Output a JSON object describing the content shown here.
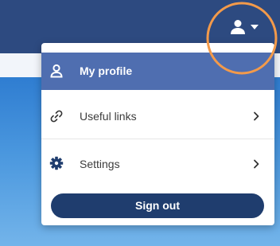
{
  "colors": {
    "header_bg": "#2d4a80",
    "menu_active_bg": "#4f6eb0",
    "signout_bg": "#1f3d6e",
    "highlight_ring": "#f39a4a",
    "hero_gradient_top": "#2f7dd1",
    "hero_gradient_bottom": "#73b4ea"
  },
  "header": {
    "user_menu": {
      "icon": "user-icon",
      "caret_icon": "caret-down-icon"
    }
  },
  "user_menu": {
    "items": [
      {
        "label": "My profile",
        "icon": "user-outline-icon",
        "active": true
      },
      {
        "label": "Useful links",
        "icon": "link-icon",
        "has_submenu": true
      },
      {
        "label": "Settings",
        "icon": "gear-icon",
        "has_submenu": true
      }
    ],
    "sign_out_label": "Sign out"
  }
}
